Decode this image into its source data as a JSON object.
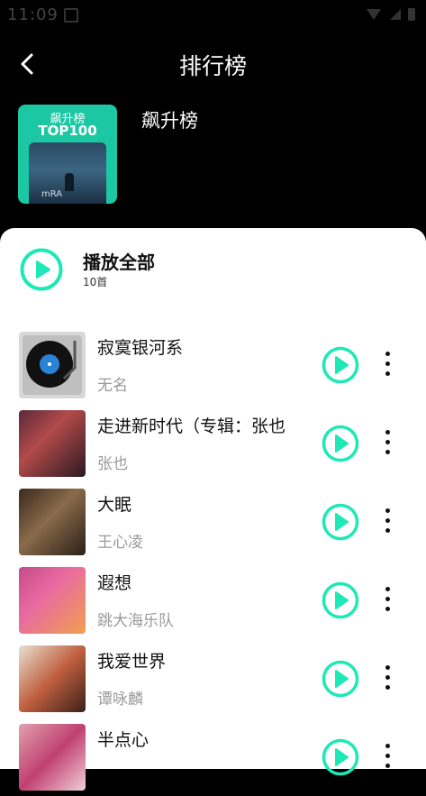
{
  "status": {
    "time": "11:09"
  },
  "header": {
    "title": "排行榜"
  },
  "chart_cover": {
    "line1": "飙升榜",
    "line2": "TOP100",
    "art_text": "mRA"
  },
  "list_name": "飙升榜",
  "play_all": {
    "label": "播放全部",
    "count": "10首"
  },
  "accent": "#1de9b6",
  "songs": [
    {
      "name": "寂寞银河系",
      "artist": "无名"
    },
    {
      "name": "走进新时代（专辑：张也",
      "artist": "张也"
    },
    {
      "name": "大眠",
      "artist": "王心凌"
    },
    {
      "name": "遐想",
      "artist": "跳大海乐队"
    },
    {
      "name": "我爱世界",
      "artist": "谭咏麟"
    },
    {
      "name": "半点心",
      "artist": ""
    }
  ]
}
